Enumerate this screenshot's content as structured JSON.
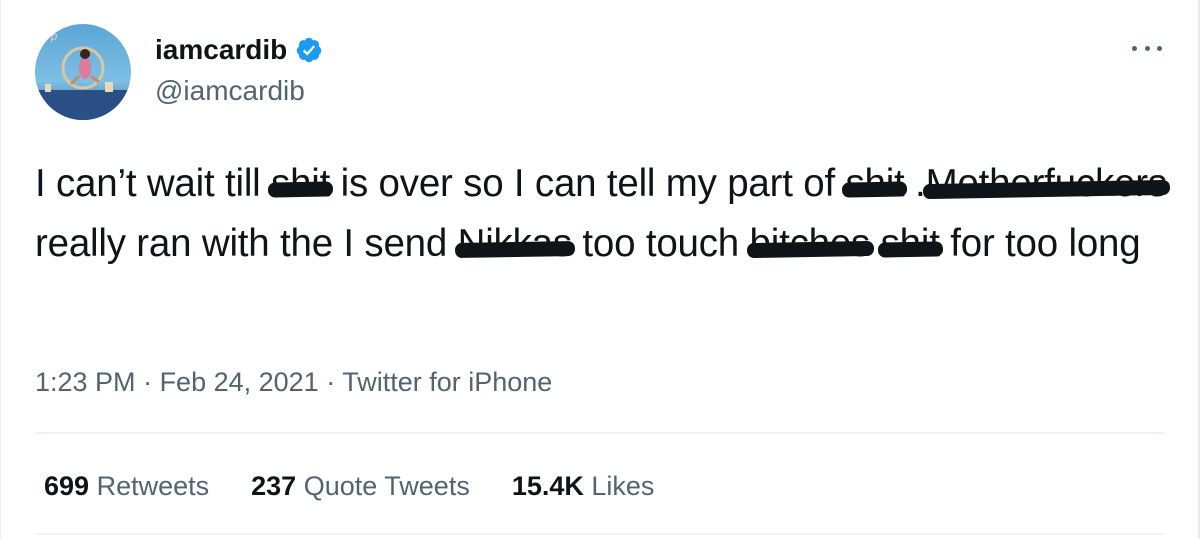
{
  "tweet": {
    "display_name": "iamcardib",
    "handle": "@iamcardib",
    "verified": true,
    "verified_color": "#1d9bf0",
    "more_icon": "more-horizontal-icon",
    "text_parts": {
      "t1": "I can’t wait till ",
      "r1": "shit",
      "t2": " is over so I can tell my part of ",
      "r2": "shit",
      "t3": " .",
      "r3": "Motherfuckers",
      "t4": " really ran with the I send ",
      "r4": "Nikkas",
      "t5": " too touch ",
      "r5": "bitches",
      "t6": " ",
      "r6": "shit",
      "t7": " for too long"
    },
    "time": "1:23 PM",
    "separator": " · ",
    "date": "Feb 24, 2021",
    "source": "Twitter for iPhone",
    "stats": {
      "retweets_count": "699",
      "retweets_label": "Retweets",
      "quotes_count": "237",
      "quotes_label": "Quote Tweets",
      "likes_count": "15.4K",
      "likes_label": "Likes"
    }
  }
}
